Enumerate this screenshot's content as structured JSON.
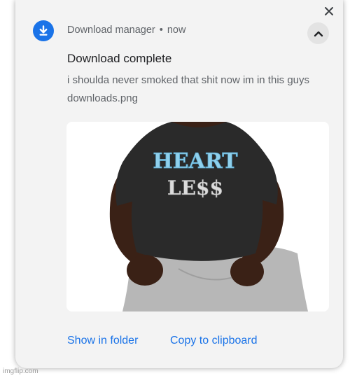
{
  "notification": {
    "app_name": "Download manager",
    "separator": "•",
    "time": "now",
    "title": "Download complete",
    "message": "i shoulda never smoked that shit now im in this guys",
    "filename": "downloads.png",
    "preview_image": {
      "description": "person in black t-shirt and grey shorts",
      "shirt_text_line1": "HEART",
      "shirt_text_line2": "LE$$"
    }
  },
  "actions": {
    "show_in_folder": "Show in folder",
    "copy_to_clipboard": "Copy to clipboard"
  },
  "icons": {
    "app": "download-icon",
    "close": "close-icon",
    "collapse": "chevron-up-icon"
  },
  "colors": {
    "accent": "#1a73e8",
    "card_background": "#f3f3f3",
    "text_secondary": "#5f6368"
  },
  "watermark": "imgflip.com"
}
